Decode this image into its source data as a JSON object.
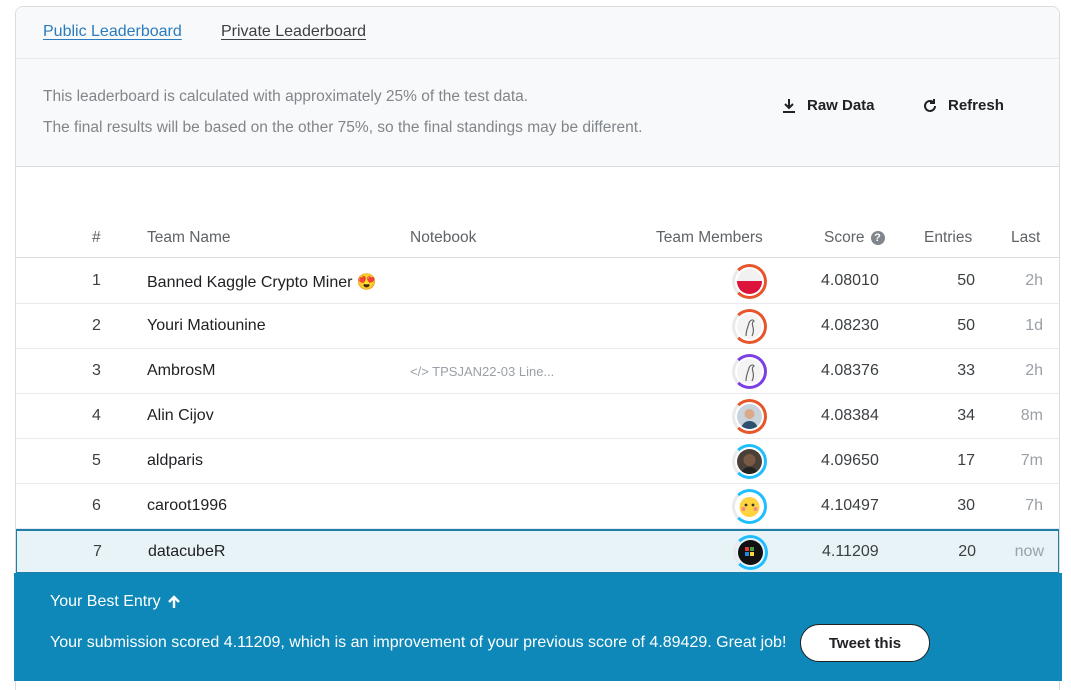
{
  "tabs": [
    {
      "label": "Public Leaderboard",
      "active": true
    },
    {
      "label": "Private Leaderboard",
      "active": false
    }
  ],
  "info": {
    "line1": "This leaderboard is calculated with approximately 25% of the test data.",
    "line2": "The final results will be based on the other 75%, so the final standings may be different."
  },
  "actions": {
    "raw_data": "Raw Data",
    "refresh": "Refresh"
  },
  "columns": {
    "rank": "#",
    "team": "Team Name",
    "notebook": "Notebook",
    "members": "Team Members",
    "score": "Score",
    "entries": "Entries",
    "last": "Last"
  },
  "rows": [
    {
      "rank": "1",
      "team": "Banned Kaggle Crypto Miner 😍",
      "notebook": "",
      "score": "4.08010",
      "entries": "50",
      "last": "2h",
      "ring_color": "#e8552a",
      "avatar": "flag"
    },
    {
      "rank": "2",
      "team": "Youri Matiounine",
      "notebook": "",
      "score": "4.08230",
      "entries": "50",
      "last": "1d",
      "ring_color": "#e8552a",
      "avatar": "sketch"
    },
    {
      "rank": "3",
      "team": "AmbrosM",
      "notebook": "</> TPSJAN22-03 Line...",
      "score": "4.08376",
      "entries": "33",
      "last": "2h",
      "ring_color": "#7b3fe4",
      "avatar": "sketch"
    },
    {
      "rank": "4",
      "team": "Alin Cijov",
      "notebook": "",
      "score": "4.08384",
      "entries": "34",
      "last": "8m",
      "ring_color": "#e8552a",
      "avatar": "photo"
    },
    {
      "rank": "5",
      "team": "aldparis",
      "notebook": "",
      "score": "4.09650",
      "entries": "17",
      "last": "7m",
      "ring_color": "#20beff",
      "avatar": "photo-dark"
    },
    {
      "rank": "6",
      "team": "caroot1996",
      "notebook": "",
      "score": "4.10497",
      "entries": "30",
      "last": "7h",
      "ring_color": "#20beff",
      "avatar": "emoji"
    },
    {
      "rank": "7",
      "team": "datacubeR",
      "notebook": "",
      "score": "4.11209",
      "entries": "20",
      "last": "now",
      "ring_color": "#20beff",
      "avatar": "cube",
      "is_me": true
    }
  ],
  "banner": {
    "title": "Your Best Entry",
    "message": "Your submission scored 4.11209, which is an improvement of your previous score of 4.89429. Great job!",
    "tweet": "Tweet this"
  },
  "colors": {
    "accent": "#2b8ac0",
    "banner": "#0d88b9",
    "highlight_row": "#e8f3f8"
  }
}
